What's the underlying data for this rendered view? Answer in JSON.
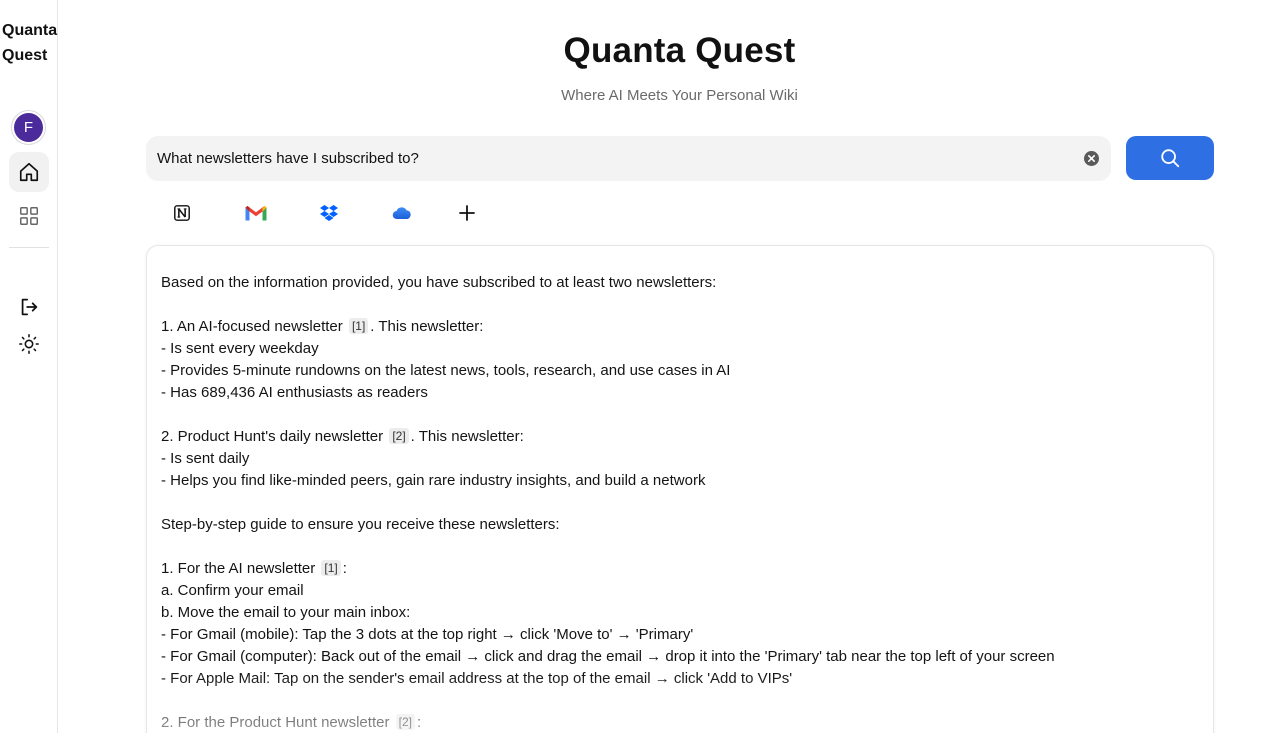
{
  "sidebar": {
    "brand": "Quanta\nQuest",
    "brand_line1": "Quanta",
    "brand_line2": "Quest",
    "avatar_initial": "F",
    "items": [
      {
        "name": "home",
        "icon": "home-icon",
        "active": true
      },
      {
        "name": "apps",
        "icon": "grid-icon",
        "active": false
      },
      {
        "name": "logout",
        "icon": "logout-icon",
        "active": false
      },
      {
        "name": "theme",
        "icon": "sun-icon",
        "active": false
      }
    ]
  },
  "header": {
    "title": "Quanta Quest",
    "subtitle": "Where AI Meets Your Personal Wiki"
  },
  "search": {
    "value": "What newsletters have I subscribed to?",
    "placeholder": "",
    "clear_icon": "clear-icon",
    "button_icon": "search-icon"
  },
  "sources": [
    {
      "name": "Notion",
      "icon": "notion-icon"
    },
    {
      "name": "Gmail",
      "icon": "gmail-icon"
    },
    {
      "name": "Dropbox",
      "icon": "dropbox-icon"
    },
    {
      "name": "iCloud",
      "icon": "cloud-icon"
    },
    {
      "name": "Add source",
      "icon": "plus-icon"
    }
  ],
  "answer": {
    "intro": "Based on the information provided, you have subscribed to at least two newsletters:",
    "item1_pre": "1. An AI-focused newsletter",
    "item1_cite": "[1]",
    "item1_post": ". This newsletter:",
    "item1_points": [
      "- Is sent every weekday",
      "- Provides 5-minute rundowns on the latest news, tools, research, and use cases in AI",
      "- Has 689,436 AI enthusiasts as readers"
    ],
    "item2_pre": "2. Product Hunt's daily newsletter",
    "item2_cite": "[2]",
    "item2_post": ". This newsletter:",
    "item2_points": [
      "- Is sent daily",
      "- Helps you find like-minded peers, gain rare industry insights, and build a network"
    ],
    "guide_heading": "Step-by-step guide to ensure you receive these newsletters:",
    "guide1_pre": "1. For the AI newsletter",
    "guide1_cite": "[1]",
    "guide1_post": ":",
    "guide1_points": [
      "a. Confirm your email",
      "b. Move the email to your main inbox:",
      "- For Gmail (mobile): Tap the 3 dots at the top right → click 'Move to' → 'Primary'",
      "- For Gmail (computer): Back out of the email → click and drag the email → drop it into the 'Primary' tab near the top left of your screen",
      "- For Apple Mail: Tap on the sender's email address at the top of the email → click 'Add to VIPs'"
    ],
    "guide2_pre": "2. For the Product Hunt newsletter",
    "guide2_cite": "[2]",
    "guide2_post": ":"
  },
  "colors": {
    "accent": "#2f6fe4",
    "avatar": "#4b2a9b",
    "search_bg": "#f3f3f3"
  }
}
